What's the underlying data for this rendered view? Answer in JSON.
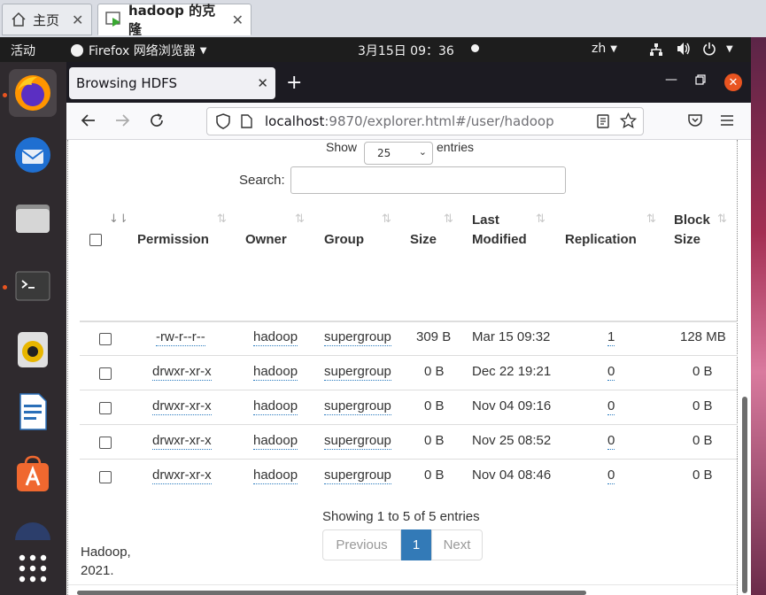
{
  "vm_tabs": [
    {
      "label": "主页",
      "icon": "home-icon"
    },
    {
      "label": "hadoop 的克隆",
      "icon": "vm-play-icon"
    }
  ],
  "topbar": {
    "activities": "活动",
    "app_name": "Firefox 网络浏览器",
    "clock": "3月15日  09：36",
    "input_method": "zh"
  },
  "browser": {
    "tab_title": "Browsing HDFS",
    "url_host": "localhost",
    "url_rest": ":9870/explorer.html#/user/hadoop"
  },
  "table": {
    "show_label": "Show",
    "entries_label": "entries",
    "page_size": "25",
    "search_label": "Search:",
    "search_value": "",
    "headers": {
      "permission": "Permission",
      "owner": "Owner",
      "group": "Group",
      "size": "Size",
      "last_modified_1": "Last",
      "last_modified_2": "Modified",
      "replication": "Replication",
      "block_size_1": "Block",
      "block_size_2": "Size"
    },
    "rows": [
      {
        "permission": "-rw-r--r--",
        "owner": "hadoop",
        "group": "supergroup",
        "size": "309 B",
        "modified": "Mar 15 09:32",
        "replication": "1",
        "block": "128 MB"
      },
      {
        "permission": "drwxr-xr-x",
        "owner": "hadoop",
        "group": "supergroup",
        "size": "0 B",
        "modified": "Dec 22 19:21",
        "replication": "0",
        "block": "0 B"
      },
      {
        "permission": "drwxr-xr-x",
        "owner": "hadoop",
        "group": "supergroup",
        "size": "0 B",
        "modified": "Nov 04 09:16",
        "replication": "0",
        "block": "0 B"
      },
      {
        "permission": "drwxr-xr-x",
        "owner": "hadoop",
        "group": "supergroup",
        "size": "0 B",
        "modified": "Nov 25 08:52",
        "replication": "0",
        "block": "0 B"
      },
      {
        "permission": "drwxr-xr-x",
        "owner": "hadoop",
        "group": "supergroup",
        "size": "0 B",
        "modified": "Nov 04 08:46",
        "replication": "0",
        "block": "0 B"
      }
    ],
    "info": "Showing 1 to 5 of 5 entries",
    "pagination": {
      "previous": "Previous",
      "current": "1",
      "next": "Next"
    }
  },
  "footer": {
    "line1": "Hadoop,",
    "line2": "2021."
  },
  "colors": {
    "accent": "#337ab7",
    "ubuntu_orange": "#e95420",
    "link_dotted": "#2a7bbf"
  }
}
